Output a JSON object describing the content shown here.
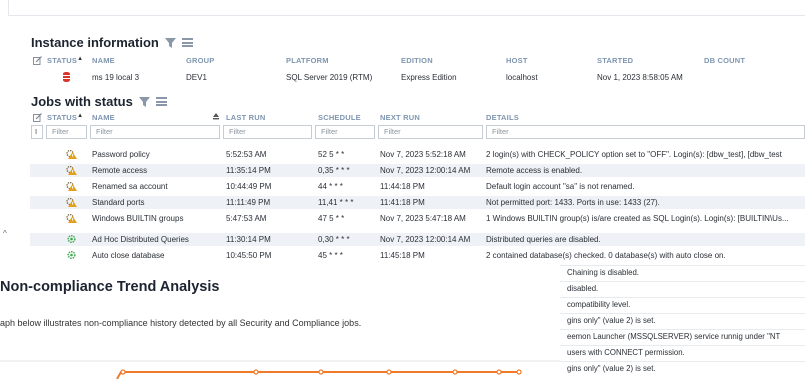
{
  "instance_info": {
    "title": "Instance information",
    "columns": [
      "STATUS",
      "NAME",
      "GROUP",
      "PLATFORM",
      "EDITION",
      "HOST",
      "STARTED",
      "DB COUNT"
    ],
    "row": {
      "name": "ms 19 local 3",
      "group": "DEV1",
      "platform": "SQL Server 2019 (RTM)",
      "edition": "Express Edition",
      "host": "localhost",
      "started": "Nov 1, 2023 8:58:05 AM"
    }
  },
  "jobs": {
    "title": "Jobs with status",
    "columns": [
      "STATUS",
      "NAME",
      "LAST RUN",
      "SCHEDULE",
      "NEXT RUN",
      "DETAILS"
    ],
    "filter_placeholder": "Filter",
    "filter_marker": "I",
    "rows": [
      {
        "name": "Password policy",
        "last_run": "5:52:53 AM",
        "schedule": "52 5 * *",
        "next_run": "Nov 7, 2023 5:52:18 AM",
        "details": "2 login(s) with CHECK_POLICY option set to \"OFF\". Login(s): [dbw_test], [dbw_test",
        "status": "warning"
      },
      {
        "name": "Remote access",
        "last_run": "11:35:14 PM",
        "schedule": "0,35 * * *",
        "next_run": "Nov 7, 2023 12:00:14 AM",
        "details": "Remote access is enabled.",
        "status": "warning"
      },
      {
        "name": "Renamed sa account",
        "last_run": "10:44:49 PM",
        "schedule": "44 * * *",
        "next_run": "11:44:18 PM",
        "details": "Default login account \"sa\" is not renamed.",
        "status": "warning"
      },
      {
        "name": "Standard ports",
        "last_run": "11:11:49 PM",
        "schedule": "11,41 * * *",
        "next_run": "11:41:18 PM",
        "details": "Not permitted port: 1433. Ports in use: 1433 (27).",
        "status": "warning"
      },
      {
        "name": "Windows BUILTIN groups",
        "last_run": "5:47:53 AM",
        "schedule": "47 5 * *",
        "next_run": "Nov 7, 2023 5:47:18 AM",
        "details": "1 Windows BUILTIN group(s) is/are created as SQL Login(s). Login(s): [BUILTIN\\Us...",
        "status": "warning"
      },
      {
        "name": "Ad Hoc Distributed Queries",
        "last_run": "11:30:14 PM",
        "schedule": "0,30 * * *",
        "next_run": "Nov 7, 2023 12:00:14 AM",
        "details": "Distributed queries are disabled.",
        "status": "ok"
      },
      {
        "name": "Auto close database",
        "last_run": "10:45:50 PM",
        "schedule": "45 * * *",
        "next_run": "11:45:18 PM",
        "details": "2 contained database(s) checked. 0 database(s) with auto close on.",
        "status": "ok"
      }
    ],
    "overflow_details": [
      "Chaining is disabled.",
      "disabled.",
      "compatibility level.",
      "gins only\" (value 2) is set.",
      "eemon Launcher (MSSQLSERVER) service runnig under \"NT",
      "users with CONNECT permission.",
      "gins only\" (value 2) is set."
    ]
  },
  "trend_popup": {
    "title": "Non-compliance Trend Analysis",
    "description": "aph below illustrates non-compliance history detected by all Security and Compliance jobs."
  },
  "colors": {
    "header_text": "#7f96b0",
    "warning": "#e0a020",
    "ok": "#3aa84a",
    "error": "#d9352c",
    "trend_line": "#f07a2a"
  }
}
